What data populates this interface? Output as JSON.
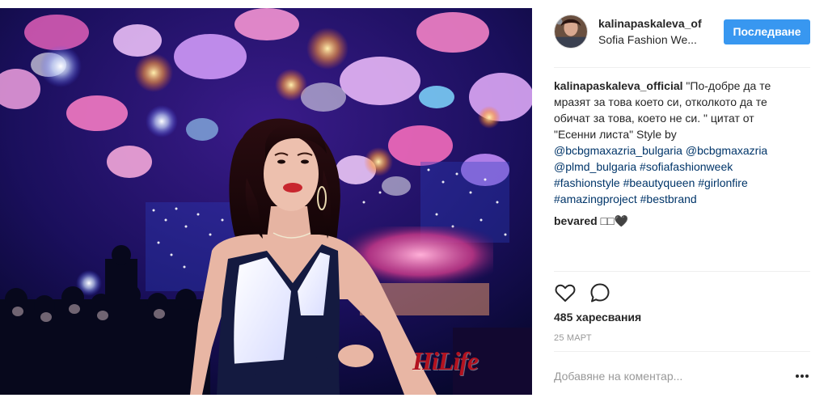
{
  "post": {
    "watermark": "HiLife",
    "author_username": "kalinapaskaleva_of",
    "location": "Sofia Fashion We...",
    "follow_label": "Последване"
  },
  "caption": {
    "author": "kalinapaskaleva_official",
    "line1_text": " \"По-добре да те",
    "line2": "мразят за това което си, отколкото да те",
    "line3": "обичат за това, което не си. \" цитат от",
    "line4": "\"Есенни листа\" Style by",
    "mention1": "@bcbgmaxazria_bulgaria",
    "mention2": "@bcbgmaxazria",
    "mention3": "@plmd_bulgaria",
    "tag1": "#sofiafashionweek",
    "tag2": "#fashionstyle",
    "tag3": "#beautyqueen",
    "tag4": "#girlonfire",
    "tag5": "#amazingproject",
    "tag6": "#bestbrand"
  },
  "comment": {
    "author": "bevared",
    "text": "□□🖤"
  },
  "actions": {
    "like_icon": "heart-icon",
    "comment_icon": "comment-icon"
  },
  "likes_text": "485 харесвания",
  "date": "25 МАРТ",
  "add_comment_placeholder": "Добавяне на коментар...",
  "more_icon": "more-options-icon"
}
